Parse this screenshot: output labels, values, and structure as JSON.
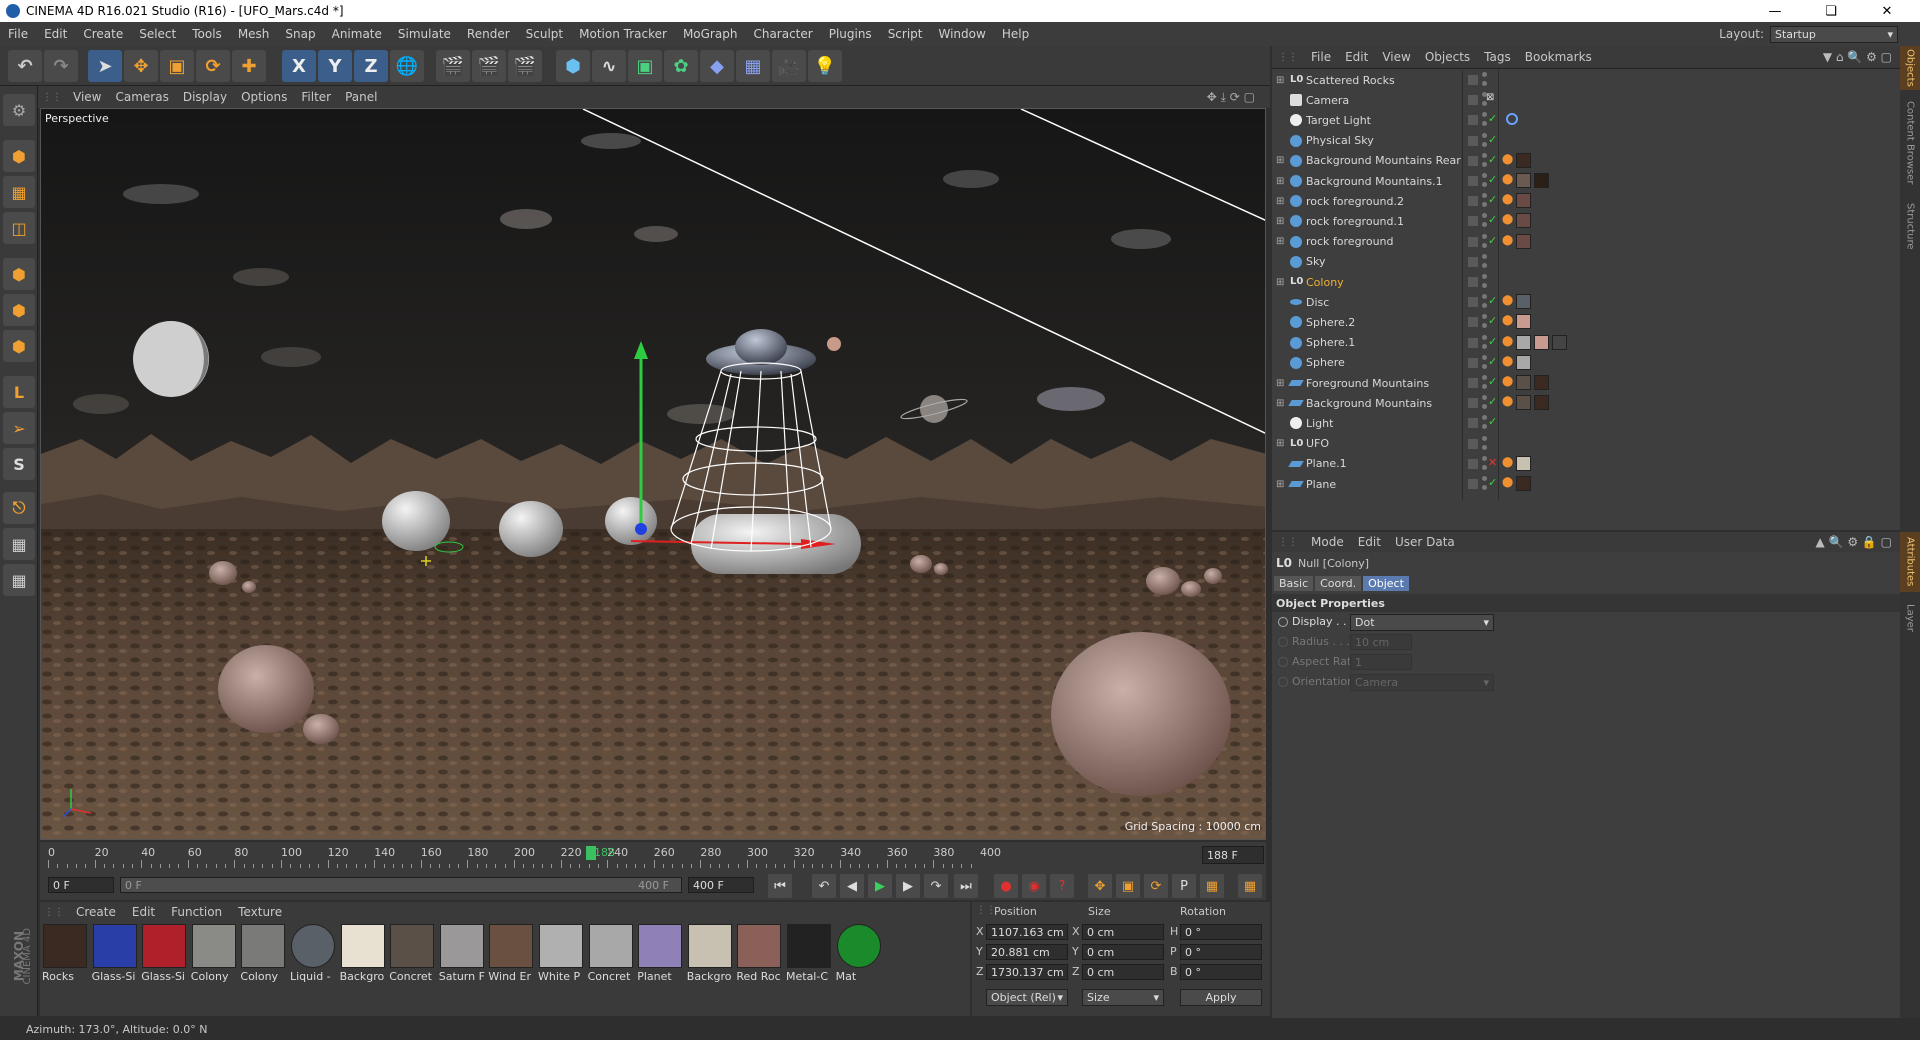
{
  "window": {
    "title": "CINEMA 4D R16.021 Studio (R16) - [UFO_Mars.c4d *]"
  },
  "menu": [
    "File",
    "Edit",
    "Create",
    "Select",
    "Tools",
    "Mesh",
    "Snap",
    "Animate",
    "Simulate",
    "Render",
    "Sculpt",
    "Motion Tracker",
    "MoGraph",
    "Character",
    "Plugins",
    "Script",
    "Window",
    "Help"
  ],
  "layout": {
    "label": "Layout:",
    "value": "Startup"
  },
  "viewport_menu": [
    "View",
    "Cameras",
    "Display",
    "Options",
    "Filter",
    "Panel"
  ],
  "viewport": {
    "camera_label": "Perspective",
    "grid_spacing": "Grid Spacing : 10000 cm"
  },
  "object_manager": {
    "menu": [
      "File",
      "Edit",
      "View",
      "Objects",
      "Tags",
      "Bookmarks"
    ],
    "objects": [
      {
        "name": "Scattered Rocks",
        "icon": "null-icon",
        "expand": true,
        "check": false
      },
      {
        "name": "Camera",
        "icon": "camera-icon",
        "expand": false,
        "check": false
      },
      {
        "name": "Target Light",
        "icon": "light-icon",
        "expand": false,
        "check": true
      },
      {
        "name": "Physical Sky",
        "icon": "sky-icon",
        "expand": false,
        "check": true
      },
      {
        "name": "Background Mountains Rear",
        "icon": "object-icon",
        "expand": true,
        "check": true
      },
      {
        "name": "Background Mountains.1",
        "icon": "object-icon",
        "expand": true,
        "check": true
      },
      {
        "name": "rock foreground.2",
        "icon": "object-icon",
        "expand": true,
        "check": true
      },
      {
        "name": "rock foreground.1",
        "icon": "object-icon",
        "expand": true,
        "check": true
      },
      {
        "name": "rock foreground",
        "icon": "object-icon",
        "expand": true,
        "check": true
      },
      {
        "name": "Sky",
        "icon": "sky-icon",
        "expand": false,
        "check": false
      },
      {
        "name": "Colony",
        "icon": "null-icon",
        "expand": true,
        "check": false,
        "selected": true
      },
      {
        "name": "Disc",
        "icon": "disc-icon",
        "expand": false,
        "check": true
      },
      {
        "name": "Sphere.2",
        "icon": "sphere-icon",
        "expand": false,
        "check": true
      },
      {
        "name": "Sphere.1",
        "icon": "sphere-icon",
        "expand": false,
        "check": true
      },
      {
        "name": "Sphere",
        "icon": "sphere-icon",
        "expand": false,
        "check": true
      },
      {
        "name": "Foreground Mountains",
        "icon": "plane-icon",
        "expand": true,
        "check": true
      },
      {
        "name": "Background Mountains",
        "icon": "plane-icon",
        "expand": true,
        "check": true
      },
      {
        "name": "Light",
        "icon": "light-icon",
        "expand": false,
        "check": true
      },
      {
        "name": "UFO",
        "icon": "null-icon",
        "expand": true,
        "check": false
      },
      {
        "name": "Plane.1",
        "icon": "plane-icon",
        "expand": false,
        "check": false,
        "disabled": true
      },
      {
        "name": "Plane",
        "icon": "plane-icon",
        "expand": true,
        "check": true
      }
    ]
  },
  "attributes": {
    "menu": [
      "Mode",
      "Edit",
      "User Data"
    ],
    "title": "Null [Colony]",
    "tabs": [
      "Basic",
      "Coord.",
      "Object"
    ],
    "active_tab": "Object",
    "section": "Object Properties",
    "props": [
      {
        "label": "Display . . . .",
        "value": "Dot",
        "enabled": true
      },
      {
        "label": "Radius . . . .",
        "value": "10 cm",
        "enabled": false
      },
      {
        "label": "Aspect Ratio",
        "value": "1",
        "enabled": false
      },
      {
        "label": "Orientation",
        "value": "Camera",
        "enabled": false
      }
    ]
  },
  "timeline": {
    "ticks": [
      "0",
      "20",
      "40",
      "60",
      "80",
      "100",
      "120",
      "140",
      "160",
      "180",
      "200",
      "220",
      "240",
      "260",
      "280",
      "300",
      "320",
      "340",
      "360",
      "380",
      "400"
    ],
    "current_frame": "188",
    "end_frame": "188 F"
  },
  "transport": {
    "start": "0 F",
    "range_start": "0 F",
    "range_end": "400 F",
    "end": "400 F"
  },
  "materials": {
    "menu": [
      "Create",
      "Edit",
      "Function",
      "Texture"
    ],
    "items": [
      {
        "label": "Rocks",
        "color": "#3a2a22"
      },
      {
        "label": "Glass-Si",
        "color": "#2a3ea8"
      },
      {
        "label": "Glass-Si",
        "color": "#b0202a"
      },
      {
        "label": "Colony",
        "color": "#8a8a86"
      },
      {
        "label": "Colony",
        "color": "#7a7a78"
      },
      {
        "label": "Liquid -",
        "color": "#5a6068"
      },
      {
        "label": "Backgro",
        "color": "#e8e0d0"
      },
      {
        "label": "Concret",
        "color": "#5a5048"
      },
      {
        "label": "Saturn F",
        "color": "#9a9898"
      },
      {
        "label": "Wind Er",
        "color": "#6a5040"
      },
      {
        "label": "White P",
        "color": "#b0b0b0"
      },
      {
        "label": "Concret",
        "color": "#a8a8a8"
      },
      {
        "label": "Planet",
        "color": "#9080b8"
      },
      {
        "label": "Backgro",
        "color": "#c8c0b0"
      },
      {
        "label": "Red Roc",
        "color": "#8a6058"
      },
      {
        "label": "Metal-C",
        "color": "#222222"
      },
      {
        "label": "Mat",
        "color": "#1a8a2a"
      }
    ]
  },
  "coordinates": {
    "headers": [
      "Position",
      "Size",
      "Rotation"
    ],
    "rows": [
      {
        "axis": "X",
        "pos": "1107.163 cm",
        "size_axis": "X",
        "size": "0 cm",
        "rot_axis": "H",
        "rot": "0 °"
      },
      {
        "axis": "Y",
        "pos": "20.881 cm",
        "size_axis": "Y",
        "size": "0 cm",
        "rot_axis": "P",
        "rot": "0 °"
      },
      {
        "axis": "Z",
        "pos": "1730.137 cm",
        "size_axis": "Z",
        "size": "0 cm",
        "rot_axis": "B",
        "rot": "0 °"
      }
    ],
    "mode": "Object (Rel)",
    "size_mode": "Size",
    "apply": "Apply"
  },
  "status": {
    "text": "Azimuth: 173.0°, Altitude: 0.0°  N"
  },
  "side_tabs": {
    "top": [
      "Objects",
      "Content Browser",
      "Structure"
    ],
    "bottom": [
      "Attributes",
      "Layer"
    ]
  },
  "brand": {
    "line1": "MAXON",
    "line2": "CINEMA 4D"
  }
}
